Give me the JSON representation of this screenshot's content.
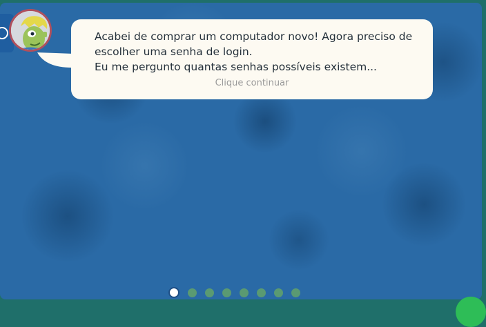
{
  "colors": {
    "background": "#2a6aa6",
    "bubble": "#fdfaf2",
    "text": "#24303a",
    "hint": "#9a9a9a",
    "dot_inactive": "#5a9a72",
    "dot_active": "#ffffff",
    "accent_green": "#2ebd57",
    "avatar_border": "#b0505d"
  },
  "side_tab": {
    "icon": "back-arrow-icon"
  },
  "avatar": {
    "icon": "character-avatar"
  },
  "dialog": {
    "lines": [
      "Acabei de comprar um computador novo! Agora preciso de",
      "escolher uma senha de login.",
      "Eu me pergunto quantas senhas possíveis existem..."
    ],
    "hint": "Clique continuar"
  },
  "pagination": {
    "total": 8,
    "current": 1
  },
  "corner_button": {
    "icon": "next-button"
  }
}
